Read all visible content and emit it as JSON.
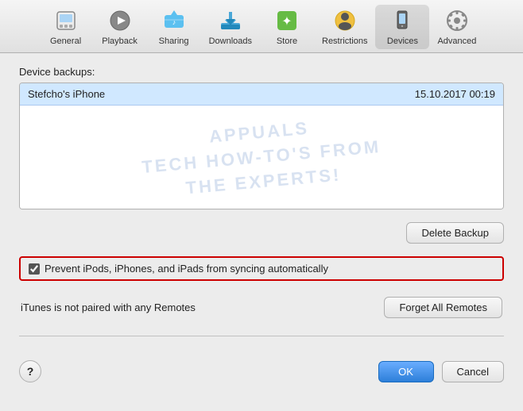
{
  "toolbar": {
    "items": [
      {
        "id": "general",
        "label": "General",
        "active": false
      },
      {
        "id": "playback",
        "label": "Playback",
        "active": false
      },
      {
        "id": "sharing",
        "label": "Sharing",
        "active": false
      },
      {
        "id": "downloads",
        "label": "Downloads",
        "active": false
      },
      {
        "id": "store",
        "label": "Store",
        "active": false
      },
      {
        "id": "restrictions",
        "label": "Restrictions",
        "active": false
      },
      {
        "id": "devices",
        "label": "Devices",
        "active": true
      },
      {
        "id": "advanced",
        "label": "Advanced",
        "active": false
      }
    ]
  },
  "main": {
    "device_backups_label": "Device backups:",
    "backup_device_name": "Stefcho's iPhone",
    "backup_date": "15.10.2017 00:19",
    "watermark_line1": "APPUALS",
    "watermark_line2": "TECH HOW-TO'S FROM",
    "watermark_line3": "THE EXPERTS!",
    "delete_backup_btn": "Delete Backup",
    "prevent_sync_label": "Prevent iPods, iPhones, and iPads from syncing automatically",
    "prevent_sync_checked": true,
    "remotes_label": "iTunes is not paired with any Remotes",
    "forget_remotes_btn": "Forget All Remotes"
  },
  "bottom": {
    "help_label": "?",
    "ok_label": "OK",
    "cancel_label": "Cancel"
  }
}
